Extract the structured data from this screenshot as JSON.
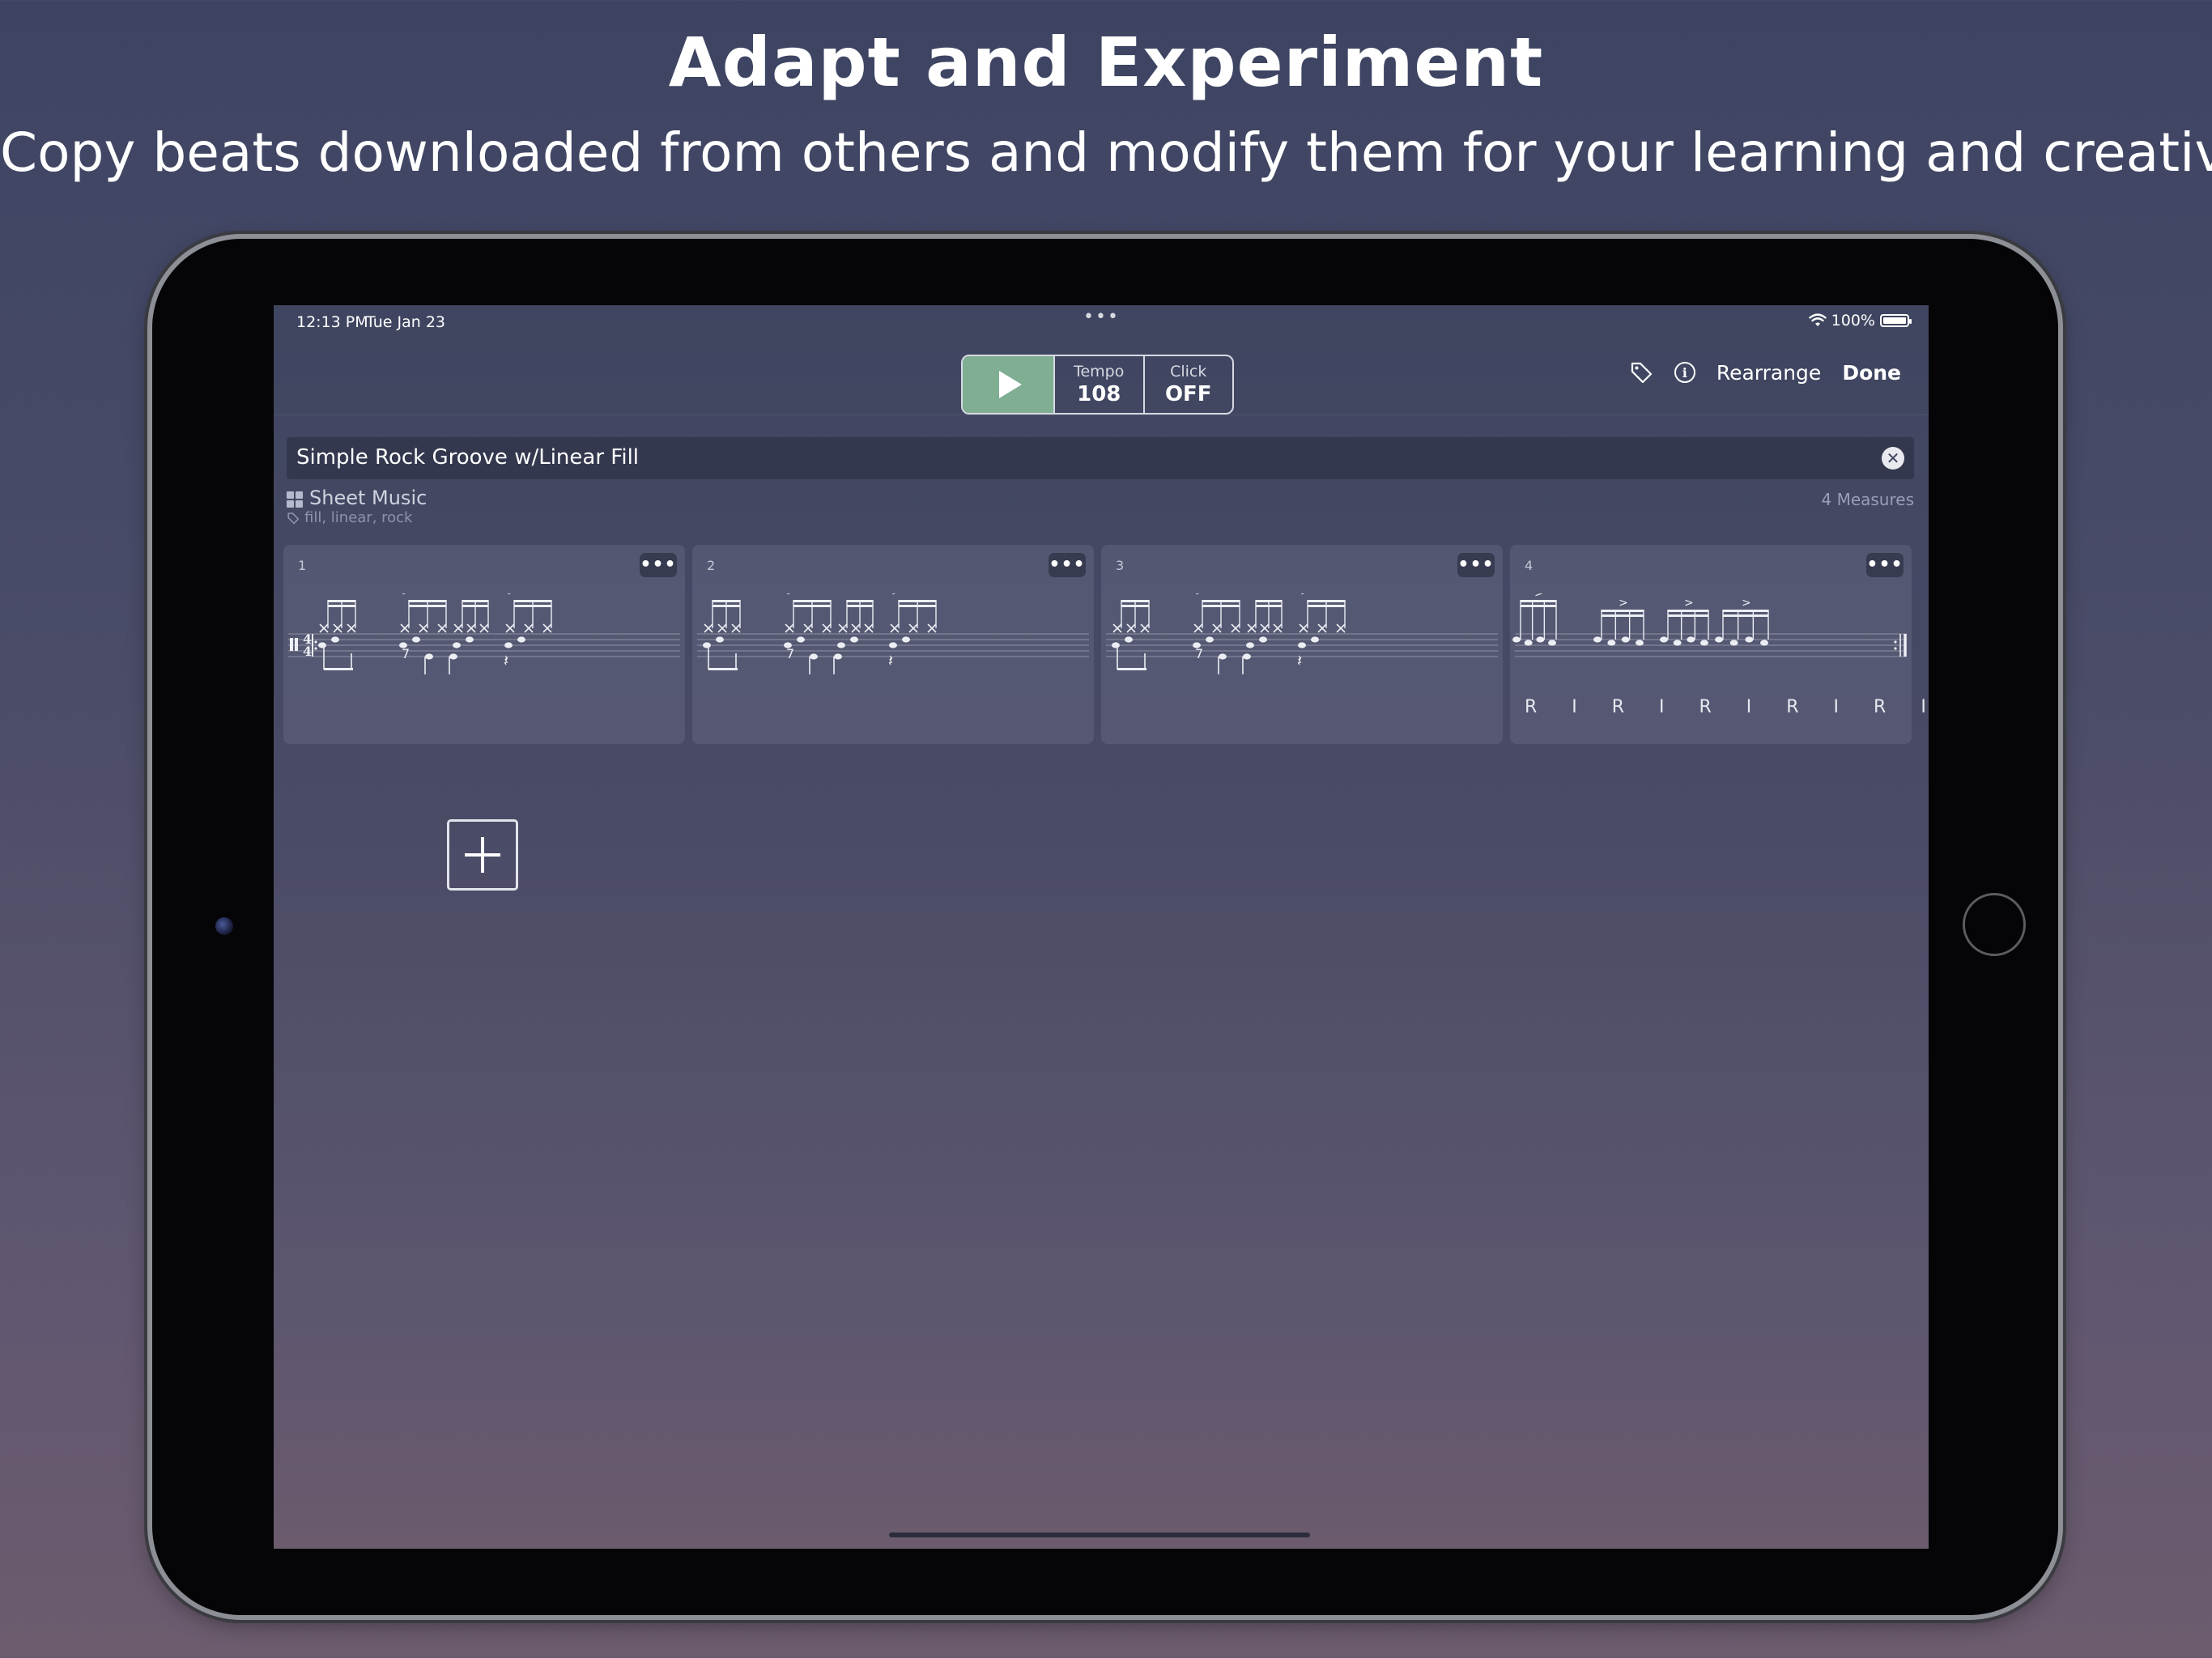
{
  "headline": "Adapt and Experiment",
  "subhead": "Copy beats downloaded from others and modify them for your learning and creativity",
  "status_bar": {
    "time": "12:13 PM",
    "date": "Tue Jan 23",
    "battery": "100%",
    "battery_level": 1.0,
    "multitask_dots": "•••"
  },
  "transport": {
    "tempo_label": "Tempo",
    "tempo_value": "108",
    "click_label": "Click",
    "click_value": "OFF",
    "play_color": "#7fae93"
  },
  "toolbar_right": {
    "tag_icon": "tag-icon",
    "info_icon": "info-icon",
    "info_glyph": "i",
    "rearrange_label": "Rearrange",
    "done_label": "Done"
  },
  "beat": {
    "title": "Simple Rock Groove w/Linear Fill",
    "clear_glyph": "✕",
    "view_mode": "Sheet Music",
    "measure_count_label": "4 Measures",
    "tags": "fill, linear, rock"
  },
  "measures": [
    {
      "number": "1",
      "more": "•••",
      "sticking": ""
    },
    {
      "number": "2",
      "more": "•••",
      "sticking": ""
    },
    {
      "number": "3",
      "more": "•••",
      "sticking": ""
    },
    {
      "number": "4",
      "more": "•••",
      "sticking": "R I R I   R I R I   R I R L"
    }
  ],
  "add_measure_icon": "plus-icon"
}
